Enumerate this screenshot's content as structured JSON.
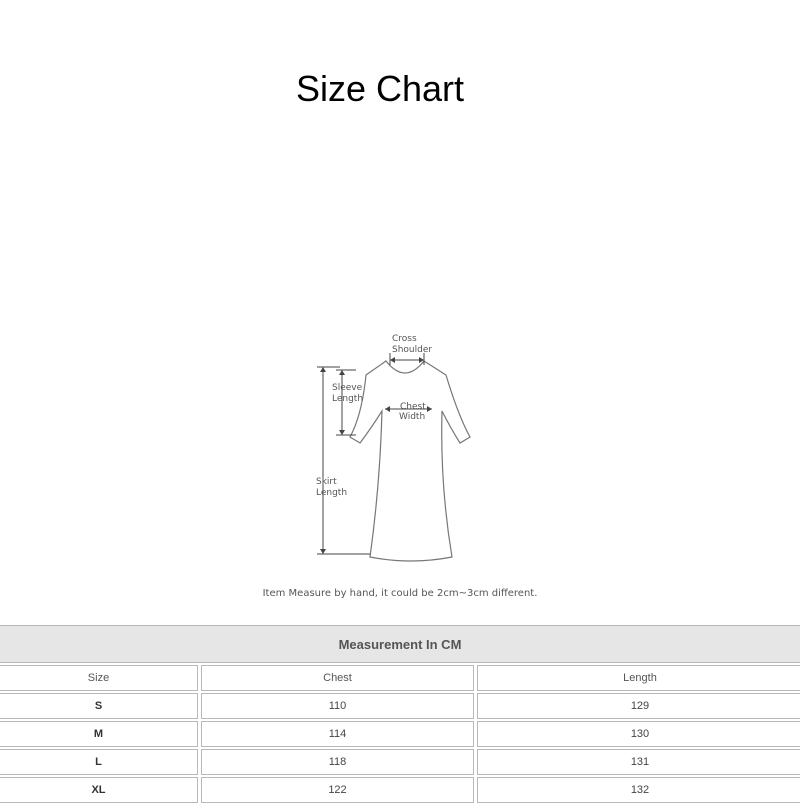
{
  "title": "Size Chart",
  "diagram": {
    "labels": {
      "cross_shoulder_1": "Cross",
      "cross_shoulder_2": "Shoulder",
      "sleeve_length_1": "Sleeve",
      "sleeve_length_2": "Length",
      "chest_width_1": "Chest",
      "chest_width_2": "Width",
      "skirt_length_1": "Skirt",
      "skirt_length_2": "Length"
    }
  },
  "note": "Item Measure by hand, it could be 2cm~3cm different.",
  "table": {
    "caption": "Measurement In CM",
    "headers": [
      "Size",
      "Chest",
      "Length"
    ],
    "rows": [
      [
        "S",
        "110",
        "129"
      ],
      [
        "M",
        "114",
        "130"
      ],
      [
        "L",
        "118",
        "131"
      ],
      [
        "XL",
        "122",
        "132"
      ]
    ]
  }
}
